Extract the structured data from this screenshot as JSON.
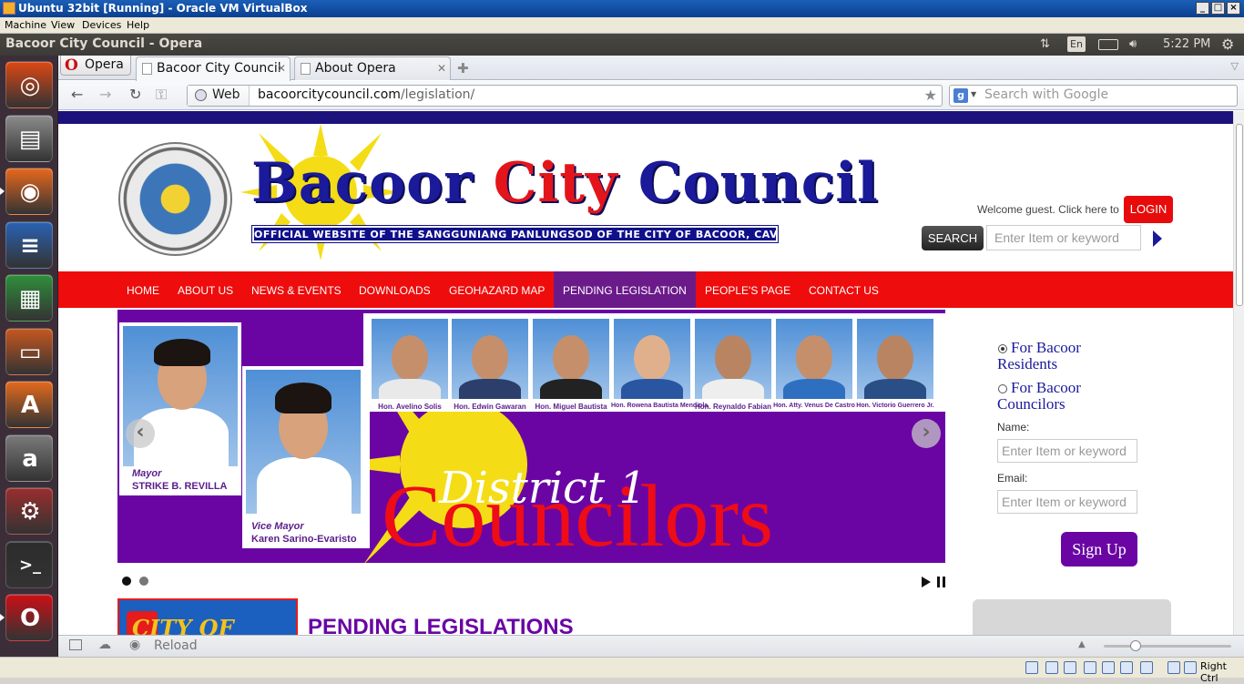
{
  "vbox": {
    "title": "Ubuntu 32bit [Running] - Oracle VM VirtualBox",
    "menu": [
      "Machine",
      "View",
      "Devices",
      "Help"
    ],
    "hostkey": "Right Ctrl"
  },
  "panel": {
    "window_title": "Bacoor City Council - Opera",
    "lang": "En",
    "clock": "5:22 PM"
  },
  "launcher": {
    "items": [
      {
        "name": "Dash Home",
        "icon": "ubuntu-logo-icon",
        "color": "#dd4814"
      },
      {
        "name": "Files",
        "icon": "file-cabinet-icon",
        "color": "#8c8c8c"
      },
      {
        "name": "Firefox",
        "icon": "firefox-icon",
        "color": "#e8681d"
      },
      {
        "name": "LibreOffice Writer",
        "icon": "writer-icon",
        "color": "#2a62b4"
      },
      {
        "name": "LibreOffice Calc",
        "icon": "calc-icon",
        "color": "#2f8f3b"
      },
      {
        "name": "LibreOffice Impress",
        "icon": "impress-icon",
        "color": "#c7571f"
      },
      {
        "name": "Ubuntu Software Center",
        "icon": "software-center-icon",
        "color": "#e46a1c"
      },
      {
        "name": "Amazon",
        "icon": "amazon-icon",
        "color": "#7a7a7a"
      },
      {
        "name": "System Settings",
        "icon": "settings-icon",
        "color": "#9a2d2d"
      },
      {
        "name": "Terminal",
        "icon": "terminal-icon",
        "color": "#2c2c2c"
      },
      {
        "name": "Opera",
        "icon": "opera-icon",
        "color": "#cc0f16"
      }
    ]
  },
  "browser": {
    "menu_label": "Opera",
    "tabs": [
      {
        "label": "Bacoor City Council",
        "active": true
      },
      {
        "label": "About Opera",
        "active": false
      }
    ],
    "address": {
      "mode": "Web",
      "host": "bacoorcitycouncil.com",
      "path": "/legislation/"
    },
    "search_placeholder": "Search with Google",
    "status_reload": "Reload",
    "zoom_level": 0.25
  },
  "site": {
    "title_blue": "Bacoor ",
    "title_red": "City ",
    "title_blue2": "Council",
    "subtitle": "OFFICIAL WEBSITE OF THE SANGGUNIANG PANLUNGSOD OF THE CITY OF BACOOR, CAVITE",
    "welcome": "Welcome guest. Click here to",
    "login": "LOGIN",
    "search_button": "SEARCH",
    "search_placeholder": "Enter Item or keyword",
    "nav": [
      "HOME",
      "ABOUT US",
      "NEWS & EVENTS",
      "DOWNLOADS",
      "GEOHAZARD MAP",
      "PENDING LEGISLATION",
      "PEOPLE'S PAGE",
      "CONTACT US"
    ],
    "nav_active": "PENDING LEGISLATION",
    "slide": {
      "mayor_role": "Mayor",
      "mayor_name": "STRIKE B. REVILLA",
      "vice_role": "Vice Mayor",
      "vice_name": "Karen Sarino-Evaristo",
      "councilors": [
        "Hon. Avelino Solis",
        "Hon. Edwin Gawaran",
        "Hon. Miguel Bautista",
        "Hon. Rowena Bautista Mendiola",
        "Hon. Reynaldo Fabian",
        "Hon. Atty. Venus De Castro",
        "Hon. Victorio Guerrero Jr."
      ],
      "district": "District 1",
      "heading": "Councilors",
      "prev": "‹",
      "next": "›"
    },
    "signup": {
      "option1": "For Bacoor Residents",
      "option2": "For Bacoor Councilors",
      "name_label": "Name:",
      "email_label": "Email:",
      "placeholder": "Enter Item or keyword",
      "button": "Sign Up"
    },
    "thumb_text": "CITY OF",
    "section_title": "PENDING LEGISLATIONS"
  }
}
